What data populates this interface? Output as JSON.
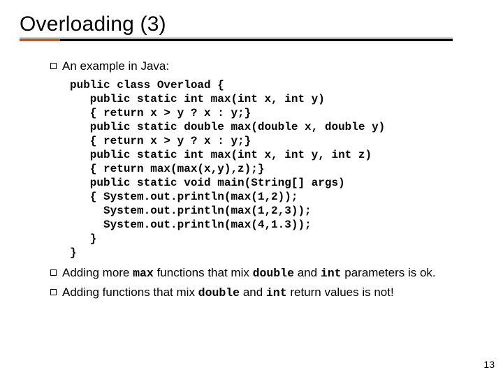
{
  "title": "Overloading (3)",
  "bullets": {
    "b1": "An example in Java:",
    "b2_pre": "Adding more ",
    "b2_max": "max",
    "b2_mid": " functions that mix ",
    "b2_dbl": "double",
    "b2_and": " and ",
    "b2_int": "int",
    "b2_post": " parameters is ok.",
    "b3_pre": "Adding functions that mix ",
    "b3_dbl": "double",
    "b3_and": " and ",
    "b3_int": "int",
    "b3_post": " return values is not!"
  },
  "code": "public class Overload {\n   public static int max(int x, int y)\n   { return x > y ? x : y;}\n   public static double max(double x, double y)\n   { return x > y ? x : y;}\n   public static int max(int x, int y, int z)\n   { return max(max(x,y),z);}\n   public static void main(String[] args)\n   { System.out.println(max(1,2));\n     System.out.println(max(1,2,3));\n     System.out.println(max(4,1.3));\n   }\n}",
  "page_number": "13"
}
